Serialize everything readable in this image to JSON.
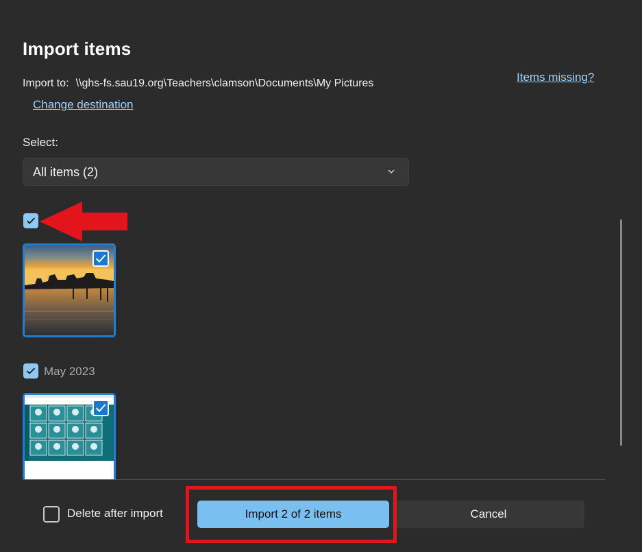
{
  "dialog": {
    "title": "Import items",
    "import_to_label": "Import to:",
    "import_to_path": "\\\\ghs-fs.sau19.org\\Teachers\\clamson\\Documents\\My Pictures",
    "change_destination": "Change destination",
    "items_missing": "Items missing?",
    "select_label": "Select:",
    "select_value": "All items (2)"
  },
  "groups": [
    {
      "label": "",
      "checked": true,
      "items": [
        {
          "kind": "photo-sunset-pier",
          "selected": true
        }
      ]
    },
    {
      "label": "May 2023",
      "checked": true,
      "items": [
        {
          "kind": "screenshot-app-grid",
          "selected": true
        }
      ]
    }
  ],
  "footer": {
    "delete_after_import": "Delete after import",
    "delete_checked": false,
    "import_button": "Import 2 of 2 items",
    "cancel_button": "Cancel"
  },
  "colors": {
    "background": "#2b2b2b",
    "accent": "#79bff0",
    "selection_border": "#1f7fd6",
    "annotation": "#e3141c"
  }
}
